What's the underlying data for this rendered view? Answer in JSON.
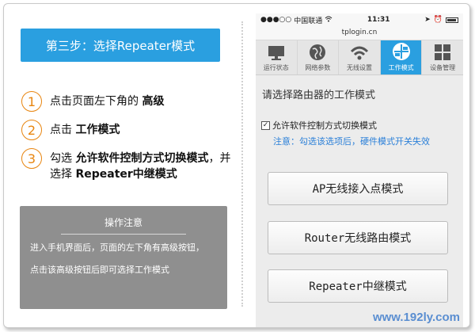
{
  "left": {
    "step_title": "第三步：选择Repeater模式",
    "steps": [
      {
        "num": "1",
        "text": "点击页面左下角的 ",
        "bold": "高级",
        "text2": ""
      },
      {
        "num": "2",
        "text": "点击 ",
        "bold": "工作模式",
        "text2": ""
      },
      {
        "num": "3",
        "text": "勾选 ",
        "bold": "允许软件控制方式切换模式",
        "text2": "，并选择 ",
        "bold2": "Repeater中继模式"
      }
    ],
    "note": {
      "title": "操作注意",
      "lines": [
        "进入手机界面后，页面的左下角有高级按钮，",
        "点击该高级按钮后即可选择工作模式"
      ]
    }
  },
  "phone": {
    "status": {
      "carrier": "中国联通",
      "time": "11:31"
    },
    "url": "tplogin.cn",
    "tabs": [
      "运行状态",
      "网络参数",
      "无线设置",
      "工作模式",
      "设备管理"
    ],
    "active_tab": 3,
    "heading": "请选择路由器的工作模式",
    "checkbox_label": "允许软件控制方式切换模式",
    "checkbox_checked": true,
    "hint": "注意：勾选该选项后，硬件模式开关失效",
    "modes": [
      "AP无线接入点模式",
      "Router无线路由模式",
      "Repeater中继模式"
    ]
  },
  "watermark": "www.192ly.com",
  "colors": {
    "accent": "#2a9fe0",
    "step_circle": "#e8850f",
    "note_bg": "#8f8f8f",
    "hint": "#2a7fd8"
  }
}
